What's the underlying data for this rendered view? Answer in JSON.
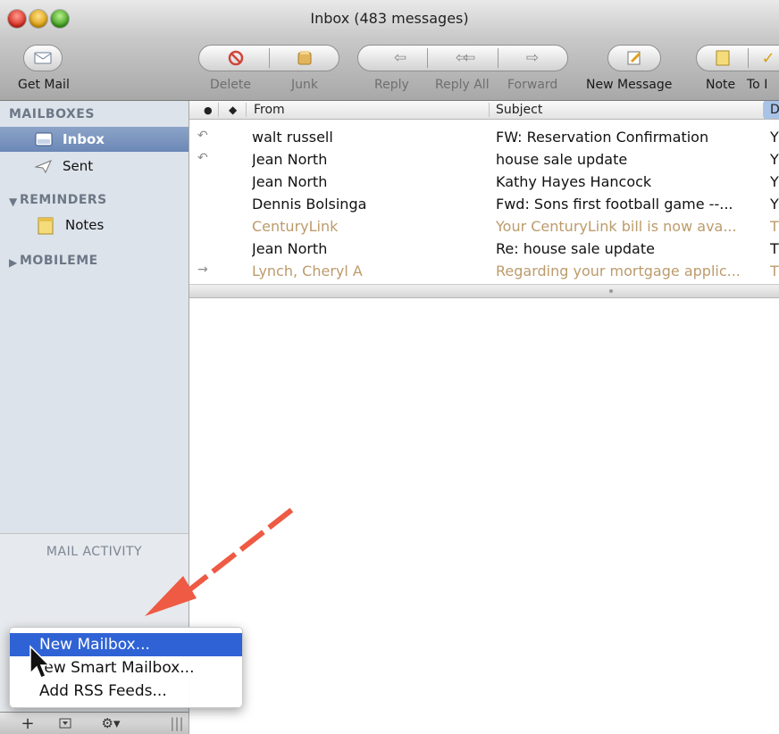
{
  "window": {
    "title": "Inbox (483 messages)"
  },
  "toolbar": {
    "buttons": [
      {
        "label": "Get Mail",
        "icon": "envelope-icon"
      },
      {
        "label": "Delete",
        "icon": "delete-icon"
      },
      {
        "label": "Junk",
        "icon": "junk-icon"
      },
      {
        "label": "Reply",
        "icon": "reply-icon"
      },
      {
        "label": "Reply All",
        "icon": "reply-all-icon"
      },
      {
        "label": "Forward",
        "icon": "forward-icon"
      },
      {
        "label": "New Message",
        "icon": "compose-icon"
      },
      {
        "label": "Note",
        "icon": "note-icon"
      },
      {
        "label": "To Do",
        "icon": "todo-icon"
      }
    ],
    "visible_todo_label": "To I"
  },
  "sidebar": {
    "mailboxes_header": "MAILBOXES",
    "inbox_label": "Inbox",
    "sent_label": "Sent",
    "reminders_header": "REMINDERS",
    "notes_label": "Notes",
    "mobileme_header": "MOBILEME",
    "mail_activity": "MAIL ACTIVITY"
  },
  "list": {
    "headers": {
      "from": "From",
      "subject": "Subject",
      "date": "D"
    },
    "rows": [
      {
        "status": "replied",
        "from": "walt russell",
        "subject": "FW: Reservation Confirmation",
        "date": "Y",
        "read": false
      },
      {
        "status": "replied",
        "from": "Jean North",
        "subject": "house sale update",
        "date": "Y",
        "read": false
      },
      {
        "status": "",
        "from": "Jean North",
        "subject": "Kathy Hayes Hancock",
        "date": "Y",
        "read": false
      },
      {
        "status": "",
        "from": "Dennis Bolsinga",
        "subject": "Fwd: Sons first football game --...",
        "date": "Y",
        "read": false
      },
      {
        "status": "",
        "from": "CenturyLink",
        "subject": "Your CenturyLink bill is now ava...",
        "date": "T",
        "read": true
      },
      {
        "status": "",
        "from": "Jean North",
        "subject": "Re: house sale update",
        "date": "T",
        "read": false
      },
      {
        "status": "forwarded",
        "from": "Lynch, Cheryl A",
        "subject": "Regarding your mortgage applic...",
        "date": "T",
        "read": true
      }
    ]
  },
  "popup_menu": {
    "items": [
      {
        "label": "New Mailbox...",
        "highlighted": true
      },
      {
        "label": "New Smart Mailbox...",
        "highlighted": false
      },
      {
        "label": "Add RSS Feeds...",
        "highlighted": false
      }
    ],
    "visible_labels": [
      "New Mailbox...",
      " ew Smart Mailbox...",
      "Add RSS Feeds..."
    ]
  },
  "colors": {
    "accent": "#2f63d5",
    "read_message": "#bc9b6b",
    "sidebar_bg": "#dde3ea",
    "annotation_arrow": "#ee5a43"
  }
}
